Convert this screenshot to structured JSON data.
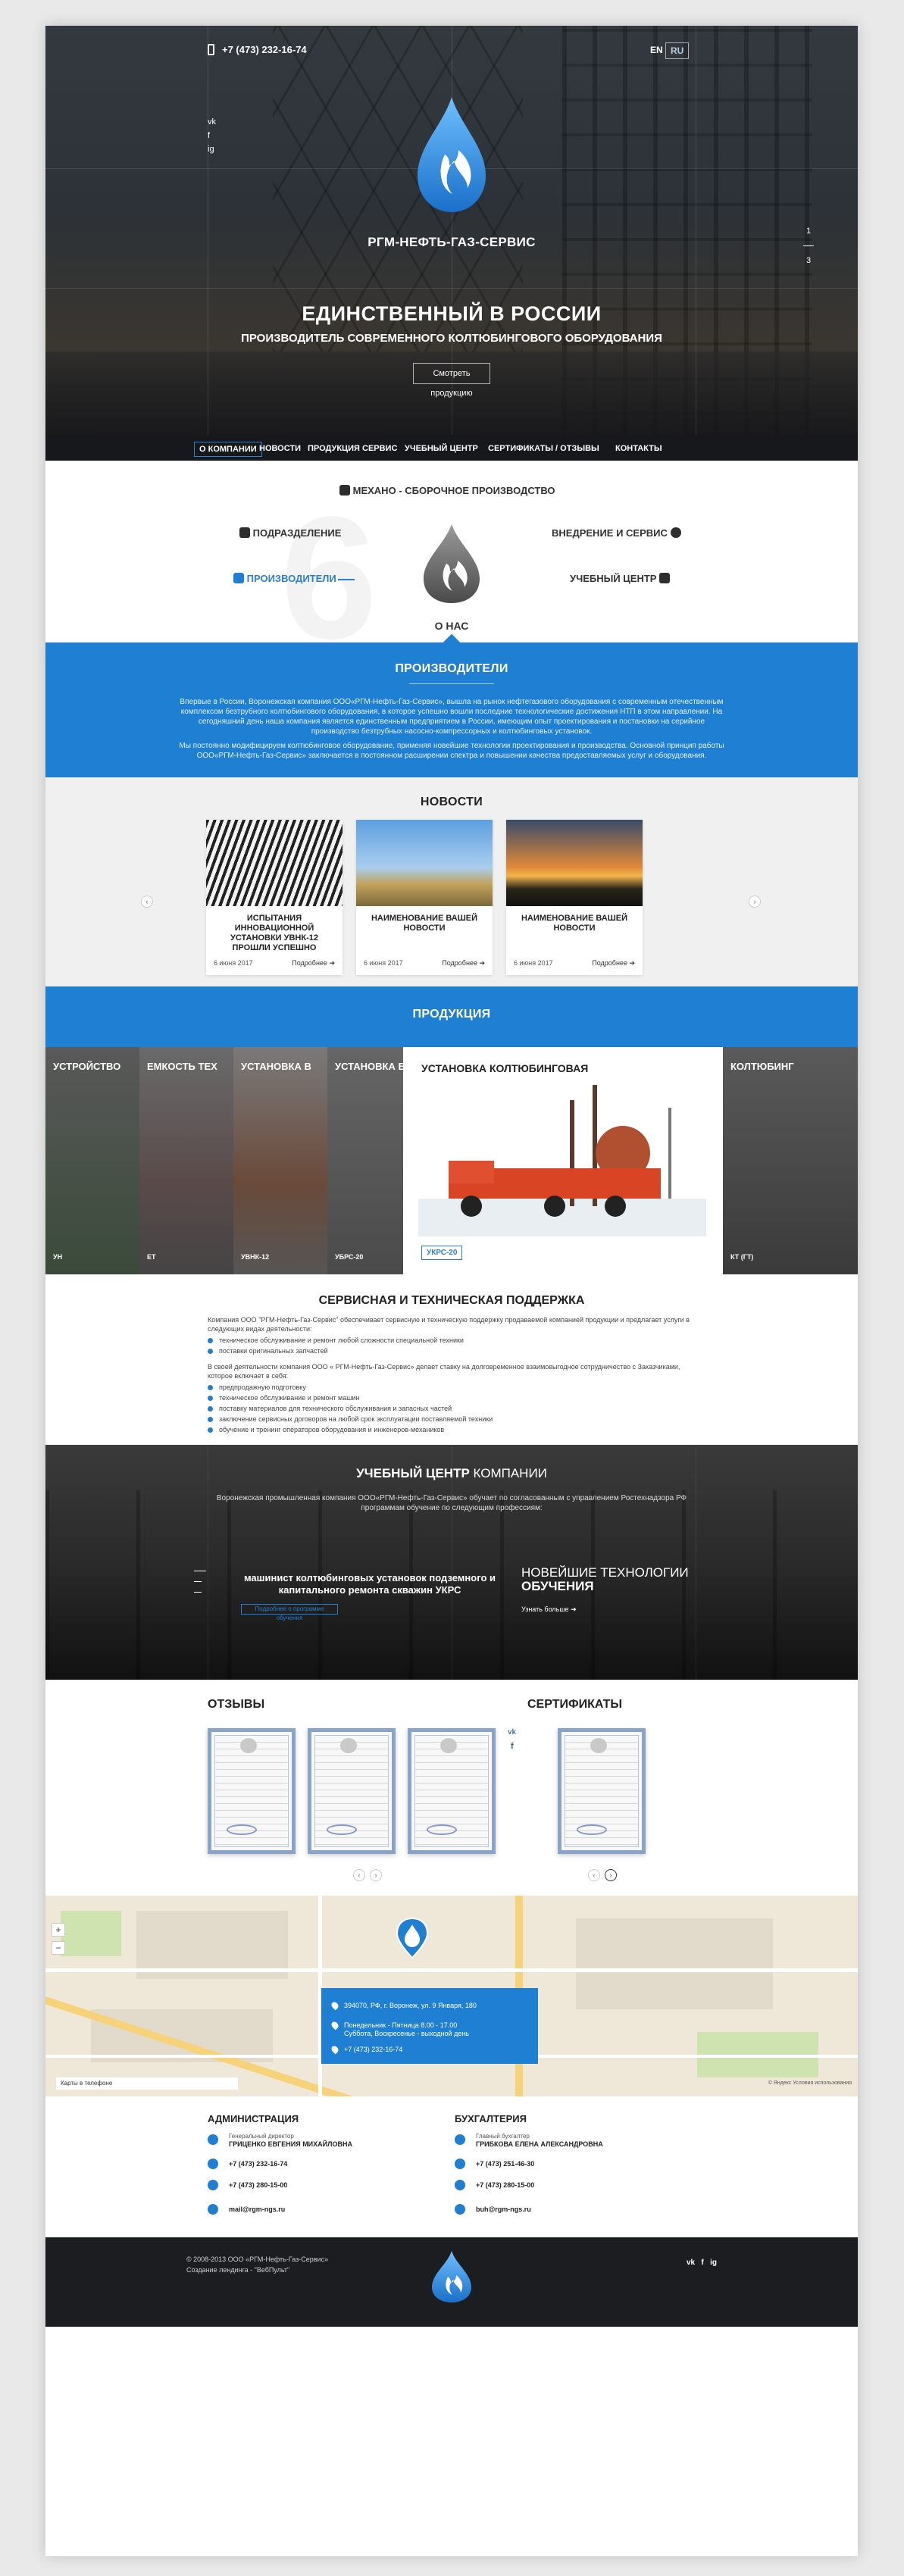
{
  "header": {
    "phone": "+7 (473) 232-16-74",
    "lang_en": "EN",
    "lang_ru": "RU",
    "social": [
      "vk",
      "f",
      "ig"
    ],
    "slide_current": "1",
    "slide_total": "3"
  },
  "hero": {
    "brand": "РГМ-НЕФТЬ-ГАЗ-СЕРВИС",
    "title": "ЕДИНСТВЕННЫЙ В РОССИИ",
    "subtitle": "ПРОИЗВОДИТЕЛЬ СОВРЕМЕННОГО КОЛТЮБИНГОВОГО ОБОРУДОВАНИЯ",
    "button": "Смотреть продукцию"
  },
  "nav": {
    "items": [
      "О КОМПАНИИ",
      "НОВОСТИ",
      "ПРОДУКЦИЯ",
      "СЕРВИС",
      "УЧЕБНЫЙ ЦЕНТР",
      "СЕРТИФИКАТЫ / ОТЗЫВЫ",
      "КОНТАКТЫ"
    ],
    "active_index": 0
  },
  "about": {
    "top_item": "МЕХАНО - СБОРОЧНОЕ ПРОИЗВОДСТВО",
    "left_item_1": "ПОДРАЗДЕЛЕНИЕ",
    "left_item_2": "ПРОИЗВОДИТЕЛИ",
    "right_item_1": "ВНЕДРЕНИЕ И СЕРВИС",
    "right_item_2": "УЧЕБНЫЙ ЦЕНТР",
    "title": "О НАС"
  },
  "manufacturers": {
    "title": "ПРОИЗВОДИТЕЛИ",
    "paragraph1": "Впервые в России, Воронежская компания ООО«РГМ-Нефть-Газ-Сервис», вышла на рынок нефтегазового оборудования с современным отечественным комплексом безтрубного колтюбингового оборудования, в которое успешно вошли последние технологические достижения НТП в этом направлении. На сегодняшний день наша компания является единственным предприятием в России, имеющим опыт проектирования и постановки на серийное производство безтрубных насосно-компрессорных и колтюбинговых установок.",
    "paragraph2": "Мы постоянно модифицируем колтюбинговое оборудование, применяя новейшие технологии проектирования и производства. Основной принцип работы ООО«РГМ-Нефть-Газ-Сервис» заключается в постоянном расширении спектра и повышении качества предоставляемых услуг и оборудования."
  },
  "news": {
    "title": "НОВОСТИ",
    "items": [
      {
        "title": "ИСПЫТАНИЯ ИННОВАЦИОННОЙ УСТАНОВКИ УВНК-12 ПРОШЛИ УСПЕШНО",
        "date": "6 июня 2017",
        "more": "Подробнее"
      },
      {
        "title": "НАИМЕНОВАНИЕ ВАШЕЙ НОВОСТИ",
        "date": "6 июня 2017",
        "more": "Подробнее"
      },
      {
        "title": "НАИМЕНОВАНИЕ ВАШЕЙ НОВОСТИ",
        "date": "6 июня 2017",
        "more": "Подробнее"
      }
    ]
  },
  "products": {
    "title": "ПРОДУКЦИЯ",
    "items": [
      {
        "title": "УСТРОЙСТВО",
        "code": "УН"
      },
      {
        "title": "ЕМКОСТЬ ТЕХ",
        "code": "ЕТ"
      },
      {
        "title": "УСТАНОВКА В",
        "code": "УВНК-12"
      },
      {
        "title": "УСТАНОВКА Б",
        "code": "УБРС-20"
      },
      {
        "title": "УСТАНОВКА КОЛТЮБИНГОВАЯ",
        "code": "УКРС-20"
      },
      {
        "title": "КОЛТЮБИНГ",
        "code": "КТ (ГТ)"
      }
    ]
  },
  "service": {
    "title": "СЕРВИСНАЯ И ТЕХНИЧЕСКАЯ ПОДДЕРЖКА",
    "intro": "Компания ООО \"РГМ-Нефть-Газ-Сервис\" обеспечивает сервисную и техническую поддержку продаваемой компанией продукции и предлагает услуги в следующих видах деятельности:",
    "list1": [
      "техническое обслуживание и ремонт любой сложности специальной техники",
      "поставки оригинальных запчастей"
    ],
    "middle": "В своей деятельности компания ООО « РГМ-Нефть-Газ-Сервис» делает ставку на долговременное взаимовыгодное сотрудничество с Заказчиками, которое включает в себя:",
    "list2": [
      "предпродажную подготовку",
      "техническое обслуживание и ремонт машин",
      "поставку материалов для технического обслуживания и запасных частей",
      "заключение сервисных договоров на любой срок эксплуатации поставляемой техники",
      "обучение и тренинг операторов оборудования и инженеров-механиков"
    ]
  },
  "training": {
    "title_bold": "УЧЕБНЫЙ ЦЕНТР",
    "title_thin": " КОМПАНИИ",
    "text": "Воронежская промышленная компания ООО«РГМ-Нефть-Газ-Сервис» обучает по согласованным с управлением Ростехнадзора РФ программам обучение по следующим профессиям:",
    "course": "машинист колтюбинговых установок подземного и капитального ремонта скважин УКРС",
    "course_btn": "Подробнее о программе обучения",
    "new_thin": "НОВЕЙШИЕ ТЕХНОЛОГИИ",
    "new_bold": "ОБУЧЕНИЯ",
    "more": "Узнать больше"
  },
  "reviews": {
    "title": "ОТЗЫВЫ"
  },
  "certificates": {
    "title": "СЕРТИФИКАТЫ"
  },
  "map": {
    "address": "394070, РФ, г. Воронеж, ул. 9 Января, 180",
    "hours1": "Понедельник - Пятница 8.00 - 17.00",
    "hours2": "Суббота, Воскресенье - выходной день",
    "phone": "+7 (473) 232-16-74",
    "map_btn": "Карты в телефоне",
    "copyright": "© Яндекс Условия использования"
  },
  "contacts": {
    "admin_title": "АДМИНИСТРАЦИЯ",
    "admin_role": "Генеральный директор",
    "admin_name": "ГРИЦЕНКО ЕВГЕНИЯ МИХАЙЛОВНА",
    "admin_phone1": "+7 (473) 232-16-74",
    "admin_phone2": "+7 (473) 280-15-00",
    "admin_mail": "mail@rgm-ngs.ru",
    "acc_title": "БУХГАЛТЕРИЯ",
    "acc_role": "Главный бухгалтер",
    "acc_name": "ГРИБКОВА ЕЛЕНА АЛЕКСАНДРОВНА",
    "acc_phone1": "+7 (473) 251-46-30",
    "acc_phone2": "+7 (473) 280-15-00",
    "acc_mail": "buh@rgm-ngs.ru"
  },
  "footer": {
    "copyright": "© 2008-2013 ООО «РГМ-Нефть-Газ-Сервис»",
    "created": "Создание лендинга - \"ВебПульт\"",
    "social": [
      "vk",
      "f",
      "ig"
    ]
  },
  "colors": {
    "accent": "#1f7fd2",
    "dark": "#16181b"
  }
}
